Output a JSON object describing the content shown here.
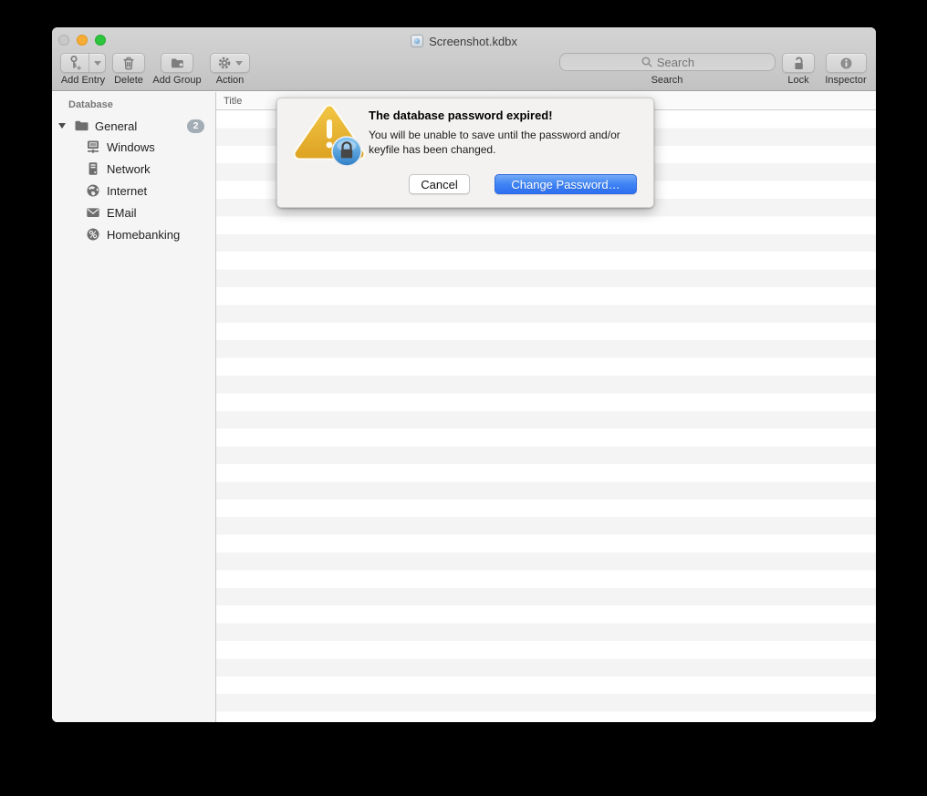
{
  "window": {
    "title": "Screenshot.kdbx"
  },
  "toolbar": {
    "add_entry_label": "Add Entry",
    "delete_label": "Delete",
    "add_group_label": "Add Group",
    "action_label": "Action",
    "search_placeholder": "Search",
    "search_label": "Search",
    "lock_label": "Lock",
    "inspector_label": "Inspector"
  },
  "sidebar": {
    "header": "Database",
    "root": {
      "label": "General",
      "badge": "2"
    },
    "items": [
      {
        "label": "Windows",
        "icon": "windows-group-icon"
      },
      {
        "label": "Network",
        "icon": "network-group-icon"
      },
      {
        "label": "Internet",
        "icon": "internet-group-icon"
      },
      {
        "label": "EMail",
        "icon": "email-group-icon"
      },
      {
        "label": "Homebanking",
        "icon": "homebanking-group-icon"
      }
    ]
  },
  "table": {
    "columns": [
      "Title"
    ]
  },
  "alert": {
    "title": "The database password expired!",
    "body": "You will be unable to save until the password and/or keyfile has been changed.",
    "cancel_label": "Cancel",
    "confirm_label": "Change Password…"
  },
  "colors": {
    "accent_blue": "#3f84f4",
    "warning_gold": "#e9b52e",
    "traffic_minimize": "#f6ac35",
    "traffic_zoom": "#2dc53d",
    "traffic_close_inactive": "#c9c9c9",
    "badge_gray": "#a3adb6"
  }
}
